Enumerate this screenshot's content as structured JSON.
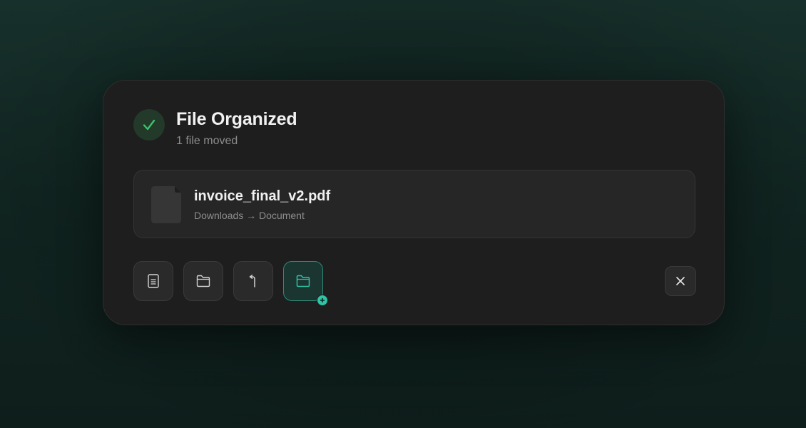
{
  "notification": {
    "title": "File Organized",
    "subtitle": "1 file moved",
    "status_icon": "check-circle-icon"
  },
  "file": {
    "name": "invoice_final_v2.pdf",
    "path": "Downloads → Document",
    "icon": "document-file-icon"
  },
  "actions": [
    {
      "name": "open-file",
      "icon": "document-icon"
    },
    {
      "name": "show-in-folder",
      "icon": "folder-icon"
    },
    {
      "name": "undo-move",
      "icon": "undo-icon"
    },
    {
      "name": "move-to-new-folder",
      "icon": "folder-plus-icon",
      "active": true
    }
  ],
  "close": {
    "icon": "close-icon"
  },
  "colors": {
    "accent": "#2ec4a5",
    "success": "#3fbf6a",
    "card_bg": "#1e1e1e"
  }
}
